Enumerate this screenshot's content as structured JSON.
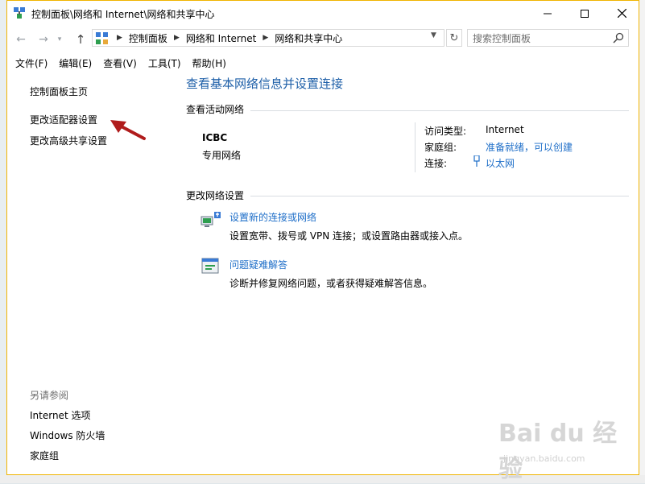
{
  "window": {
    "title": "控制面板\\网络和 Internet\\网络和共享中心"
  },
  "navigation": {
    "breadcrumbs": [
      "控制面板",
      "网络和 Internet",
      "网络和共享中心"
    ],
    "search_placeholder": "搜索控制面板"
  },
  "menu": [
    "文件(F)",
    "编辑(E)",
    "查看(V)",
    "工具(T)",
    "帮助(H)"
  ],
  "sidebar": {
    "home": "控制面板主页",
    "links": [
      "更改适配器设置",
      "更改高级共享设置"
    ],
    "see_also_label": "另请参阅",
    "see_also": [
      "Internet 选项",
      "Windows 防火墙",
      "家庭组"
    ]
  },
  "main": {
    "heading": "查看基本网络信息并设置连接",
    "active_networks_label": "查看活动网络",
    "network": {
      "name": "ICBC",
      "type": "专用网络",
      "props": [
        {
          "label": "访问类型:",
          "value": "Internet"
        },
        {
          "label": "家庭组:",
          "value": "准备就绪，可以创建"
        },
        {
          "label": "连接:",
          "value": "以太网"
        }
      ]
    },
    "change_settings_label": "更改网络设置",
    "tasks": [
      {
        "title": "设置新的连接或网络",
        "desc": "设置宽带、拨号或 VPN 连接；或设置路由器或接入点。"
      },
      {
        "title": "问题疑难解答",
        "desc": "诊断并修复网络问题，或者获得疑难解答信息。"
      }
    ]
  },
  "watermark": {
    "logo": "Bai du 经验",
    "url": "jingyan.baidu.com"
  },
  "colors": {
    "link": "#1e6ec8",
    "heading": "#1e5fa8",
    "window_border": "#f0b400",
    "annotation_arrow": "#b01c1c"
  }
}
